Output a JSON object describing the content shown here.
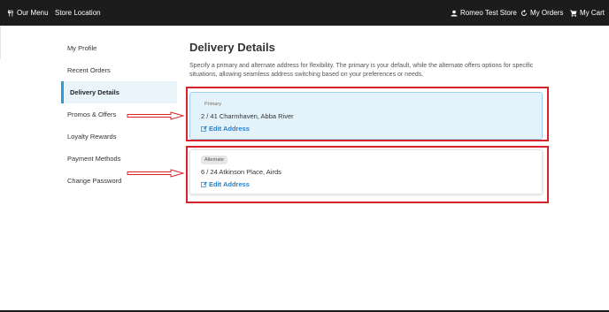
{
  "navbar": {
    "our_menu": "Our Menu",
    "store_location": "Store Location",
    "account": "Romeo Test Store",
    "my_orders": "My Orders",
    "my_cart": "My Cart"
  },
  "sidebar": {
    "items": [
      {
        "label": "My Profile"
      },
      {
        "label": "Recent Orders"
      },
      {
        "label": "Delivery Details"
      },
      {
        "label": "Promos & Offers"
      },
      {
        "label": "Loyalty Rewards"
      },
      {
        "label": "Payment Methods"
      },
      {
        "label": "Change Password"
      }
    ],
    "active": "Delivery Details"
  },
  "main": {
    "title": "Delivery Details",
    "description": "Specify a primary and alternate address for flexibility. The primary is your default, while the alternate offers options for specific situations, allowing seamless address switching based on your preferences or needs.",
    "addresses": [
      {
        "badge": "Primary",
        "address": "2 / 41 Charmhaven, Abba River",
        "edit_label": "Edit Address"
      },
      {
        "badge": "Alternate",
        "address": "6 / 24 Atkinson Place, Airds",
        "edit_label": "Edit Address"
      }
    ]
  },
  "icons": {
    "our_menu": "utensils-icon",
    "account": "user-icon",
    "my_orders": "refresh-icon",
    "my_cart": "cart-icon",
    "edit": "edit-icon"
  },
  "colors": {
    "navbar_bg": "#1c1c1c",
    "accent": "#2d9cdb",
    "link": "#2d7fc1",
    "primary_card_bg": "#e3f2fb",
    "annotation_red": "#d8232a"
  }
}
